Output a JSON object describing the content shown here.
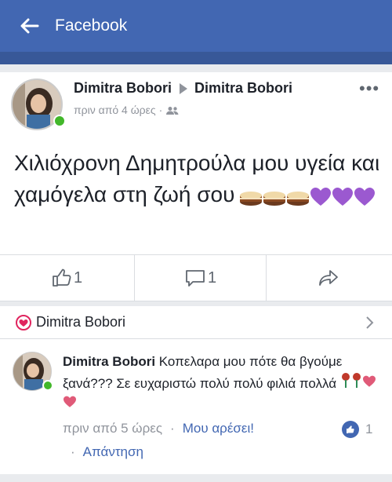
{
  "topbar": {
    "title": "Facebook",
    "back_icon": "back-arrow-icon",
    "color": "#4267b2"
  },
  "post": {
    "author": "Dimitra Bobori",
    "target": "Dimitra Bobori",
    "time": "πριν από 4 ώρες",
    "separator": "·",
    "audience_icon": "friends-icon",
    "more": "•••",
    "text": "Χιλιόχρονη Δημητρούλα μου υγεία και χαμόγελα στη ζωή σου",
    "emojis": [
      "cake",
      "cake",
      "cake",
      "purple-heart",
      "purple-heart",
      "purple-heart"
    ],
    "likes": "1",
    "comments": "1"
  },
  "comments_section": {
    "header_name": "Dimitra Bobori",
    "comment": {
      "author": "Dimitra Bobori",
      "text": "Κοπελαρα μου πότε θα βγούμε ξανά??? Σε ευχαριστώ πολύ πολύ φιλιά πολλά",
      "emojis": [
        "rose",
        "rose",
        "heart",
        "heart"
      ],
      "time": "πριν από 5 ώρες",
      "separator": "·",
      "like_label": "Μου αρέσει!",
      "like_count": "1",
      "reply_bullet": "·",
      "reply_label": "Απάντηση"
    }
  },
  "colors": {
    "facebook_blue": "#4267b2",
    "online_green": "#42b72a",
    "meta_gray": "#90949c"
  }
}
